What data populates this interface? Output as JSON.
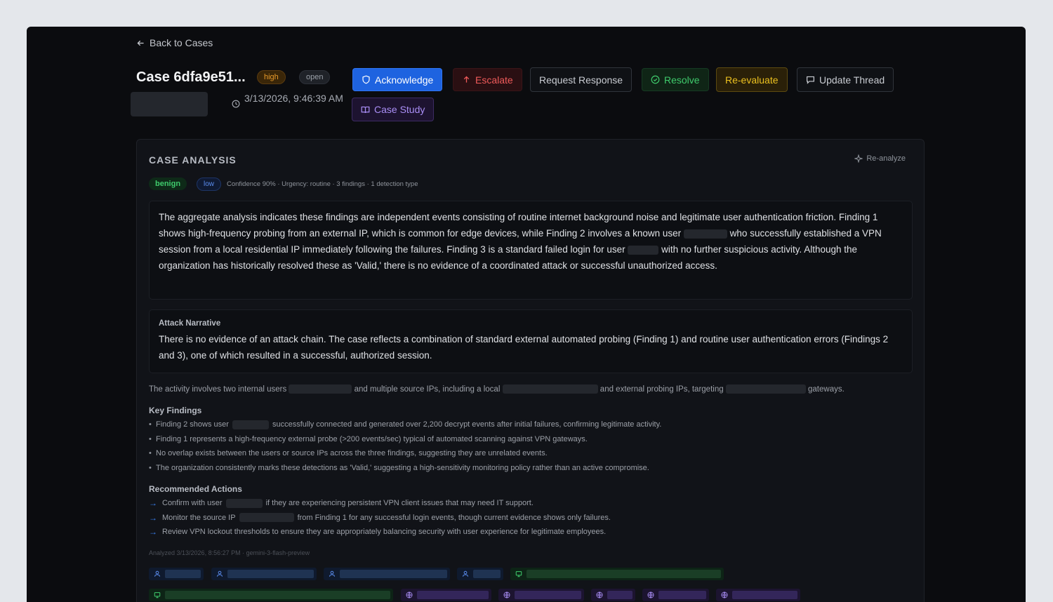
{
  "nav": {
    "back_label": "Back to Cases"
  },
  "case": {
    "title": "Case 6dfa9e51...",
    "severity": "high",
    "status": "open",
    "timestamp": "3/13/2026, 9:46:39 AM"
  },
  "actions": {
    "acknowledge": "Acknowledge",
    "escalate": "Escalate",
    "request_response": "Request Response",
    "resolve": "Resolve",
    "reevaluate": "Re-evaluate",
    "update_thread": "Update Thread",
    "case_study": "Case Study"
  },
  "analysis": {
    "title": "CASE ANALYSIS",
    "reanalyze": "Re-analyze",
    "verdict": "benign",
    "risk": "low",
    "meta": "Confidence 90% · Urgency: routine · 3 findings · 1 detection type",
    "summary": {
      "p1": "The aggregate analysis indicates these findings are independent events consisting of routine internet background noise and legitimate user authentication friction. Finding 1 shows high-frequency probing from an external IP, which is common for edge devices, while Finding 2 involves a known user",
      "p2": "who successfully established a VPN session from a local residential IP immediately following the failures. Finding 3 is a standard failed login for user",
      "p3": "with no further suspicious activity. Although the organization has historically resolved these as 'Valid,' there is no evidence of a coordinated attack or successful unauthorized access."
    },
    "narrative_title": "Attack Narrative",
    "narrative": "There is no evidence of an attack chain. The case reflects a combination of standard external automated probing (Finding 1) and routine user authentication errors (Findings 2 and 3), one of which resulted in a successful, authorized session.",
    "scope": {
      "a": "The activity involves two internal users",
      "b": "and multiple source IPs, including a local",
      "c": "and external probing IPs, targeting",
      "d": "gateways."
    },
    "key_findings_title": "Key Findings",
    "key_findings": {
      "f1a": "Finding 2 shows user",
      "f1b": "successfully connected and generated over 2,200 decrypt events after initial failures, confirming legitimate activity.",
      "f2": "Finding 1 represents a high-frequency external probe (>200 events/sec) typical of automated scanning against VPN gateways.",
      "f3": "No overlap exists between the users or source IPs across the three findings, suggesting they are unrelated events.",
      "f4": "The organization consistently marks these detections as 'Valid,' suggesting a high-sensitivity monitoring policy rather than an active compromise."
    },
    "recommended_title": "Recommended Actions",
    "recommended": {
      "r1a": "Confirm with user",
      "r1b": "if they are experiencing persistent VPN client issues that may need IT support.",
      "r2a": "Monitor the source IP",
      "r2b": "from Finding 1 for any successful login events, though current evidence shows only failures.",
      "r3": "Review VPN lockout thresholds to ensure they are appropriately balancing security with user experience for legitimate employees."
    },
    "analyzed": "Analyzed 3/13/2026, 8:56:27 PM · gemini-3-flash-preview"
  },
  "icons": {
    "back": "arrow-left-icon",
    "clock": "clock-icon",
    "shield": "shield-icon",
    "arrow_up": "arrow-up-icon",
    "check": "check-circle-icon",
    "message": "message-square-icon",
    "book": "book-open-icon",
    "sparkle": "sparkle-icon",
    "user": "user-icon",
    "monitor": "monitor-icon",
    "globe": "globe-icon"
  },
  "colors": {
    "primary": "#1e63e0",
    "danger": "#ef5a5a",
    "success": "#3fcb6c",
    "warning": "#ecc11f",
    "purple": "#a98ef5"
  }
}
